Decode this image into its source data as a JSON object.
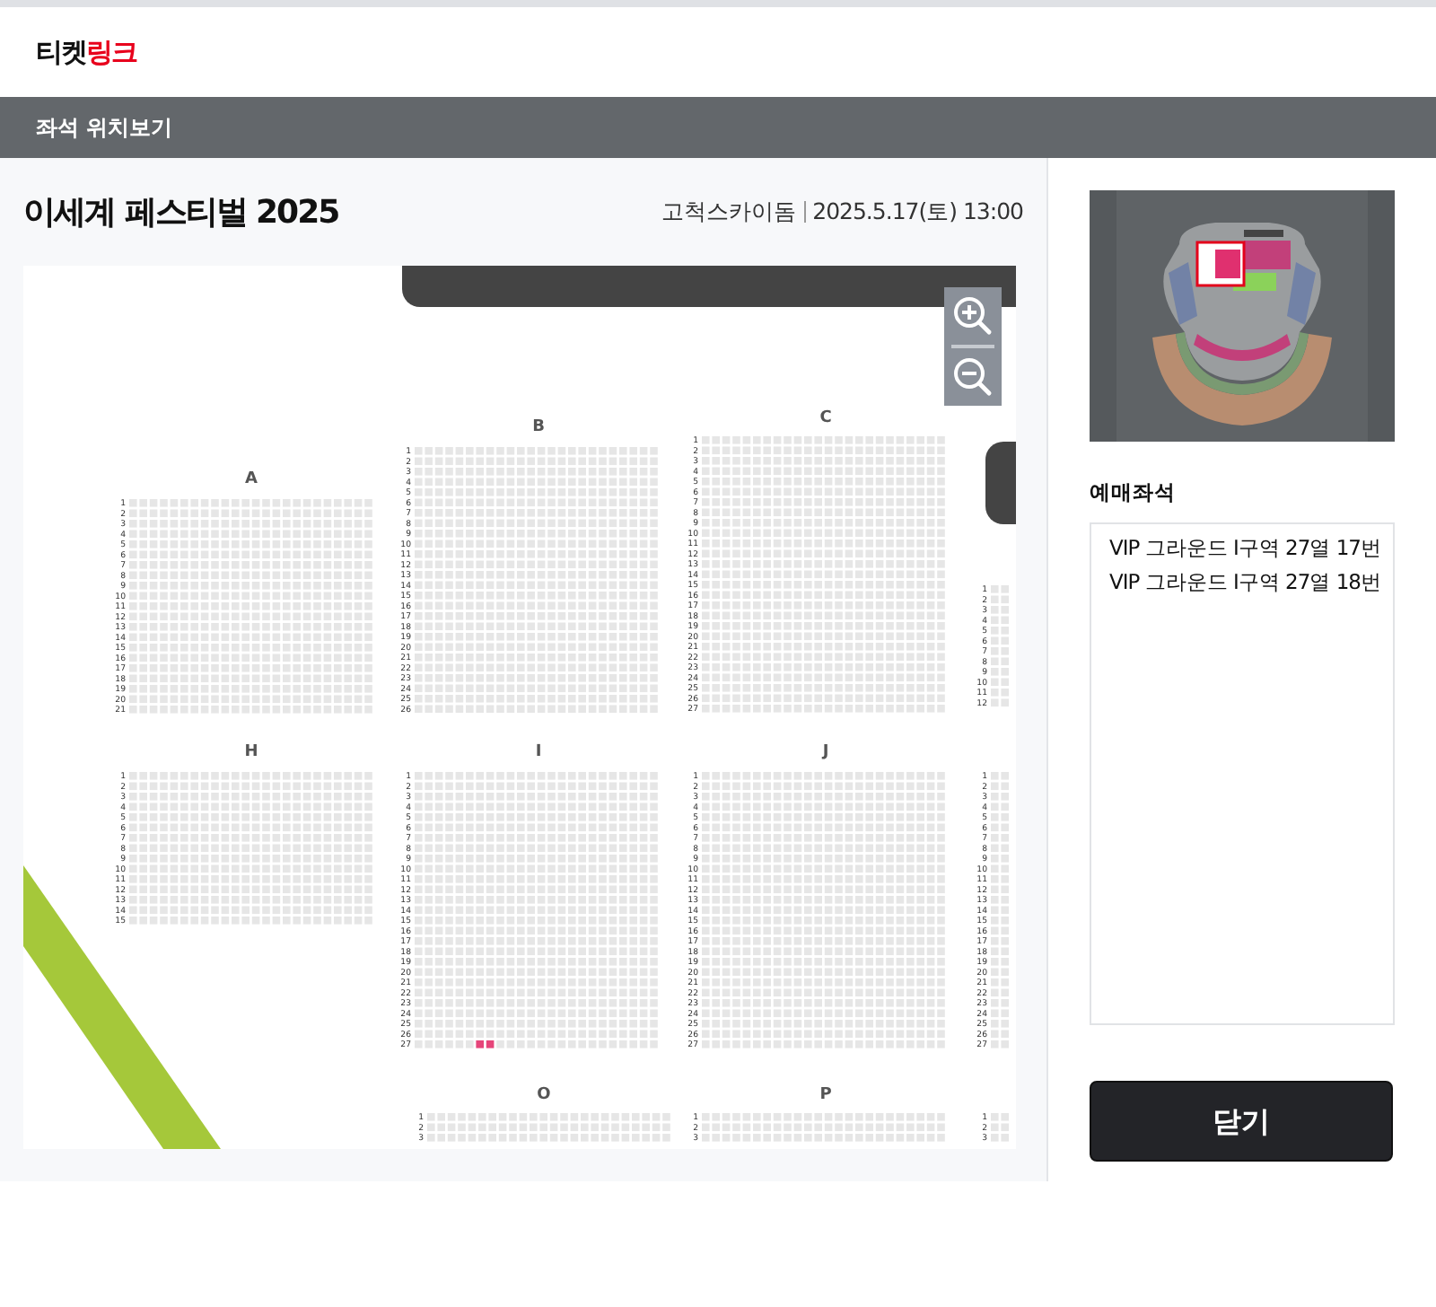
{
  "logo": [
    {
      "text": "티켓",
      "accent": false
    },
    {
      "text": "링크",
      "accent": true
    }
  ],
  "nav": {
    "title": "좌석 위치보기"
  },
  "event": {
    "title": "이세계 페스티벌 2025",
    "venue": "고척스카이돔",
    "datetime": "2025.5.17(토) 13:00"
  },
  "seat_map": {
    "blocks": [
      {
        "label": "A",
        "rows": [
          {
            "number": "1"
          },
          {
            "number": "2"
          },
          {
            "number": "3"
          },
          {
            "number": "4"
          },
          {
            "number": "5"
          },
          {
            "number": "6"
          },
          {
            "number": "7"
          },
          {
            "number": "8"
          },
          {
            "number": "9"
          },
          {
            "number": "10"
          },
          {
            "number": "11"
          },
          {
            "number": "12"
          },
          {
            "number": "13"
          },
          {
            "number": "14"
          },
          {
            "number": "15"
          },
          {
            "number": "16"
          },
          {
            "number": "17"
          },
          {
            "number": "18"
          },
          {
            "number": "19"
          },
          {
            "number": "20"
          },
          {
            "number": "21"
          }
        ]
      },
      {
        "label": "B",
        "rows": [
          {
            "number": "1"
          },
          {
            "number": "2"
          },
          {
            "number": "3"
          },
          {
            "number": "4"
          },
          {
            "number": "5"
          },
          {
            "number": "6"
          },
          {
            "number": "7"
          },
          {
            "number": "8"
          },
          {
            "number": "9"
          },
          {
            "number": "10"
          },
          {
            "number": "11"
          },
          {
            "number": "12"
          },
          {
            "number": "13"
          },
          {
            "number": "14"
          },
          {
            "number": "15"
          },
          {
            "number": "16"
          },
          {
            "number": "17"
          },
          {
            "number": "18"
          },
          {
            "number": "19"
          },
          {
            "number": "20"
          },
          {
            "number": "21"
          },
          {
            "number": "22"
          },
          {
            "number": "23"
          },
          {
            "number": "24"
          },
          {
            "number": "25"
          },
          {
            "number": "26"
          }
        ]
      },
      {
        "label": "C",
        "rows": [
          {
            "number": "1"
          },
          {
            "number": "2"
          },
          {
            "number": "3"
          },
          {
            "number": "4"
          },
          {
            "number": "5"
          },
          {
            "number": "6"
          },
          {
            "number": "7"
          },
          {
            "number": "8"
          },
          {
            "number": "9"
          },
          {
            "number": "10"
          },
          {
            "number": "11"
          },
          {
            "number": "12"
          },
          {
            "number": "13"
          },
          {
            "number": "14"
          },
          {
            "number": "15"
          },
          {
            "number": "16"
          },
          {
            "number": "17"
          },
          {
            "number": "18"
          },
          {
            "number": "19"
          },
          {
            "number": "20"
          },
          {
            "number": "21"
          },
          {
            "number": "22"
          },
          {
            "number": "23"
          },
          {
            "number": "24"
          },
          {
            "number": "25"
          },
          {
            "number": "26"
          },
          {
            "number": "27"
          }
        ]
      },
      {
        "rows": [
          {
            "number": "1"
          },
          {
            "number": "2"
          },
          {
            "number": "3"
          },
          {
            "number": "4"
          },
          {
            "number": "5"
          },
          {
            "number": "6"
          },
          {
            "number": "7"
          },
          {
            "number": "8"
          },
          {
            "number": "9"
          },
          {
            "number": "10"
          },
          {
            "number": "11"
          },
          {
            "number": "12"
          }
        ]
      },
      {
        "label": "H",
        "rows": [
          {
            "number": "1"
          },
          {
            "number": "2"
          },
          {
            "number": "3"
          },
          {
            "number": "4"
          },
          {
            "number": "5"
          },
          {
            "number": "6"
          },
          {
            "number": "7"
          },
          {
            "number": "8"
          },
          {
            "number": "9"
          },
          {
            "number": "10"
          },
          {
            "number": "11"
          },
          {
            "number": "12"
          },
          {
            "number": "13"
          },
          {
            "number": "14"
          },
          {
            "number": "15"
          }
        ]
      },
      {
        "label": "I",
        "rows": [
          {
            "number": "1"
          },
          {
            "number": "2"
          },
          {
            "number": "3"
          },
          {
            "number": "4"
          },
          {
            "number": "5"
          },
          {
            "number": "6"
          },
          {
            "number": "7"
          },
          {
            "number": "8"
          },
          {
            "number": "9"
          },
          {
            "number": "10"
          },
          {
            "number": "11"
          },
          {
            "number": "12"
          },
          {
            "number": "13"
          },
          {
            "number": "14"
          },
          {
            "number": "15"
          },
          {
            "number": "16"
          },
          {
            "number": "17"
          },
          {
            "number": "18"
          },
          {
            "number": "19"
          },
          {
            "number": "20"
          },
          {
            "number": "21"
          },
          {
            "number": "22"
          },
          {
            "number": "23"
          },
          {
            "number": "24"
          },
          {
            "number": "25"
          },
          {
            "number": "26"
          },
          {
            "number": "27",
            "seats": [
              {
                "selected": false
              },
              {
                "selected": false
              },
              {
                "selected": false
              },
              {
                "selected": false
              },
              {
                "selected": false
              },
              {
                "selected": false
              },
              {
                "selected": true
              },
              {
                "selected": true
              },
              {
                "selected": false
              },
              {
                "selected": false
              },
              {
                "selected": false
              },
              {
                "selected": false
              },
              {
                "selected": false
              },
              {
                "selected": false
              },
              {
                "selected": false
              },
              {
                "selected": false
              },
              {
                "selected": false
              },
              {
                "selected": false
              },
              {
                "selected": false
              },
              {
                "selected": false
              },
              {
                "selected": false
              },
              {
                "selected": false
              },
              {
                "selected": false
              },
              {
                "selected": false
              }
            ]
          }
        ]
      },
      {
        "label": "J",
        "rows": [
          {
            "number": "1"
          },
          {
            "number": "2"
          },
          {
            "number": "3"
          },
          {
            "number": "4"
          },
          {
            "number": "5"
          },
          {
            "number": "6"
          },
          {
            "number": "7"
          },
          {
            "number": "8"
          },
          {
            "number": "9"
          },
          {
            "number": "10"
          },
          {
            "number": "11"
          },
          {
            "number": "12"
          },
          {
            "number": "13"
          },
          {
            "number": "14"
          },
          {
            "number": "15"
          },
          {
            "number": "16"
          },
          {
            "number": "17"
          },
          {
            "number": "18"
          },
          {
            "number": "19"
          },
          {
            "number": "20"
          },
          {
            "number": "21"
          },
          {
            "number": "22"
          },
          {
            "number": "23"
          },
          {
            "number": "24"
          },
          {
            "number": "25"
          },
          {
            "number": "26"
          },
          {
            "number": "27"
          }
        ]
      },
      {
        "rows": [
          {
            "number": "1"
          },
          {
            "number": "2"
          },
          {
            "number": "3"
          },
          {
            "number": "4"
          },
          {
            "number": "5"
          },
          {
            "number": "6"
          },
          {
            "number": "7"
          },
          {
            "number": "8"
          },
          {
            "number": "9"
          },
          {
            "number": "10"
          },
          {
            "number": "11"
          },
          {
            "number": "12"
          },
          {
            "number": "13"
          },
          {
            "number": "14"
          },
          {
            "number": "15"
          },
          {
            "number": "16"
          },
          {
            "number": "17"
          },
          {
            "number": "18"
          },
          {
            "number": "19"
          },
          {
            "number": "20"
          },
          {
            "number": "21"
          },
          {
            "number": "22"
          },
          {
            "number": "23"
          },
          {
            "number": "24"
          },
          {
            "number": "25"
          },
          {
            "number": "26"
          },
          {
            "number": "27"
          }
        ]
      },
      {
        "label": "O",
        "rows": [
          {
            "number": "1"
          },
          {
            "number": "2"
          },
          {
            "number": "3"
          }
        ]
      },
      {
        "label": "P",
        "rows": [
          {
            "number": "1"
          },
          {
            "number": "2"
          },
          {
            "number": "3"
          }
        ]
      },
      {
        "rows": [
          {
            "number": "1"
          },
          {
            "number": "2"
          },
          {
            "number": "3"
          }
        ]
      }
    ]
  },
  "booked": {
    "heading": "예매좌석",
    "seats": [
      "VIP 그라운드 I구역 27열 17번",
      "VIP 그라운드 I구역 27열 18번"
    ]
  },
  "close_button": {
    "label": "닫기"
  }
}
